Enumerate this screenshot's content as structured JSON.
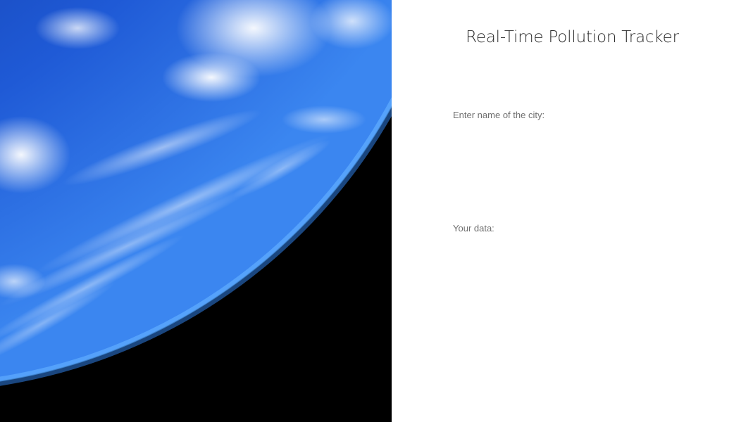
{
  "app": {
    "title": "Real-Time Pollution Tracker"
  },
  "hero": {
    "image": "earth-from-space",
    "colors": {
      "space": "#000000",
      "ocean_deep": "#0a1f6b",
      "ocean": "#1f5ad6",
      "atmosphere": "#4fa3ff",
      "clouds": "#ffffff"
    }
  },
  "form": {
    "city_label": "Enter name of the city:",
    "city_value": "",
    "city_placeholder": ""
  },
  "results": {
    "label": "Your data:",
    "content": ""
  }
}
